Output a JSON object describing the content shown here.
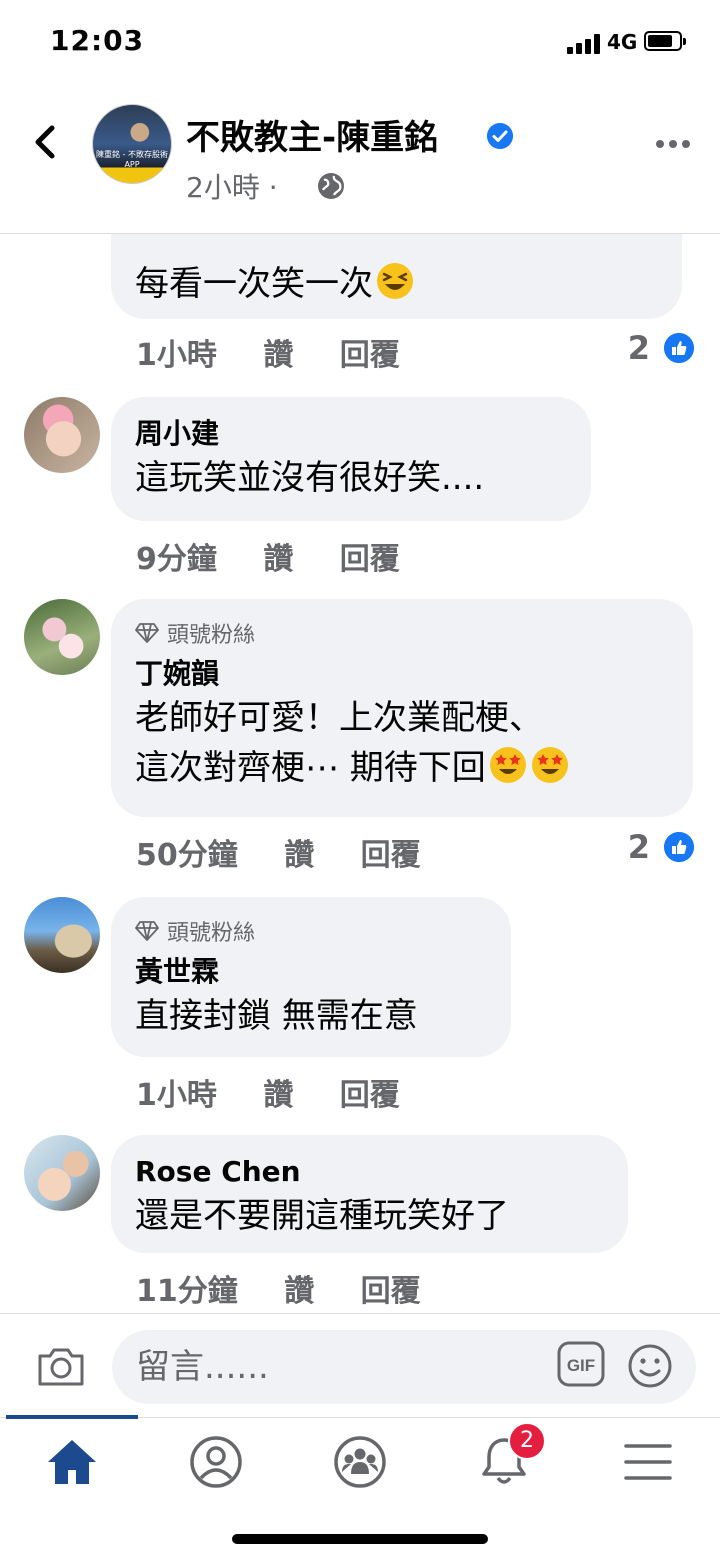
{
  "status_bar": {
    "time": "12:03",
    "network": "4G"
  },
  "header": {
    "page_name": "不敗教主-陳重銘",
    "post_time": "2小時 ·",
    "avatar_banner": "陳重銘 - 不敗存股術APP"
  },
  "actions": {
    "like": "讚",
    "reply": "回覆"
  },
  "comments": [
    {
      "author": "",
      "badge": "",
      "lines": [
        "每看一次笑一次"
      ],
      "time": "1小時",
      "reactions": "2"
    },
    {
      "author": "周小建",
      "badge": "",
      "lines": [
        "這玩笑並沒有很好笑...."
      ],
      "time": "9分鐘",
      "reactions": ""
    },
    {
      "author": "丁婉韻",
      "badge": "頭號粉絲",
      "lines": [
        "老師好可愛！上次業配梗、",
        "這次對齊梗⋯ 期待下回"
      ],
      "time": "50分鐘",
      "reactions": "2"
    },
    {
      "author": "黃世霖",
      "badge": "頭號粉絲",
      "lines": [
        "直接封鎖 無需在意"
      ],
      "time": "1小時",
      "reactions": ""
    },
    {
      "author": "Rose Chen",
      "badge": "",
      "lines": [
        "還是不要開這種玩笑好了"
      ],
      "time": "11分鐘",
      "reactions": ""
    }
  ],
  "composer": {
    "placeholder": "留言......"
  },
  "tabbar": {
    "notification_count": "2"
  },
  "colors": {
    "accent": "#1877f2",
    "bubble": "#f0f2f5",
    "muted": "#65676b",
    "badge": "#e41e3f"
  }
}
